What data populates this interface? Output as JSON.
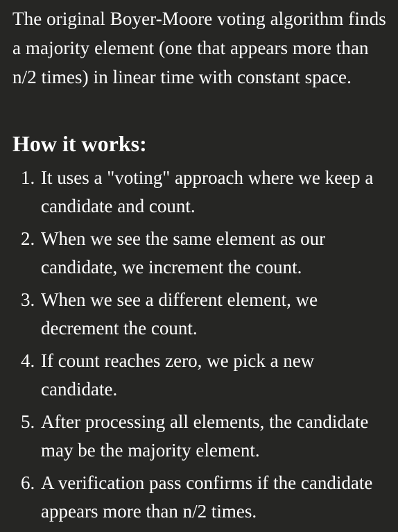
{
  "intro": "The original Boyer-Moore voting algorithm finds a majority element (one that appears more than n/2 times) in linear time with constant space.",
  "heading": "How it works:",
  "steps": [
    {
      "num": "1.",
      "text": "It uses a \"voting\" approach where we keep a candidate and count."
    },
    {
      "num": "2.",
      "text": "When we see the same element as our candidate, we increment the count."
    },
    {
      "num": "3.",
      "text": "When we see a different element, we decrement the count."
    },
    {
      "num": "4.",
      "text": "If count reaches zero, we pick a new candidate."
    },
    {
      "num": "5.",
      "text": "After processing all elements, the candidate may be the majority element."
    },
    {
      "num": "6.",
      "text": "A verification pass confirms if the candidate appears more than n/2 times."
    }
  ]
}
